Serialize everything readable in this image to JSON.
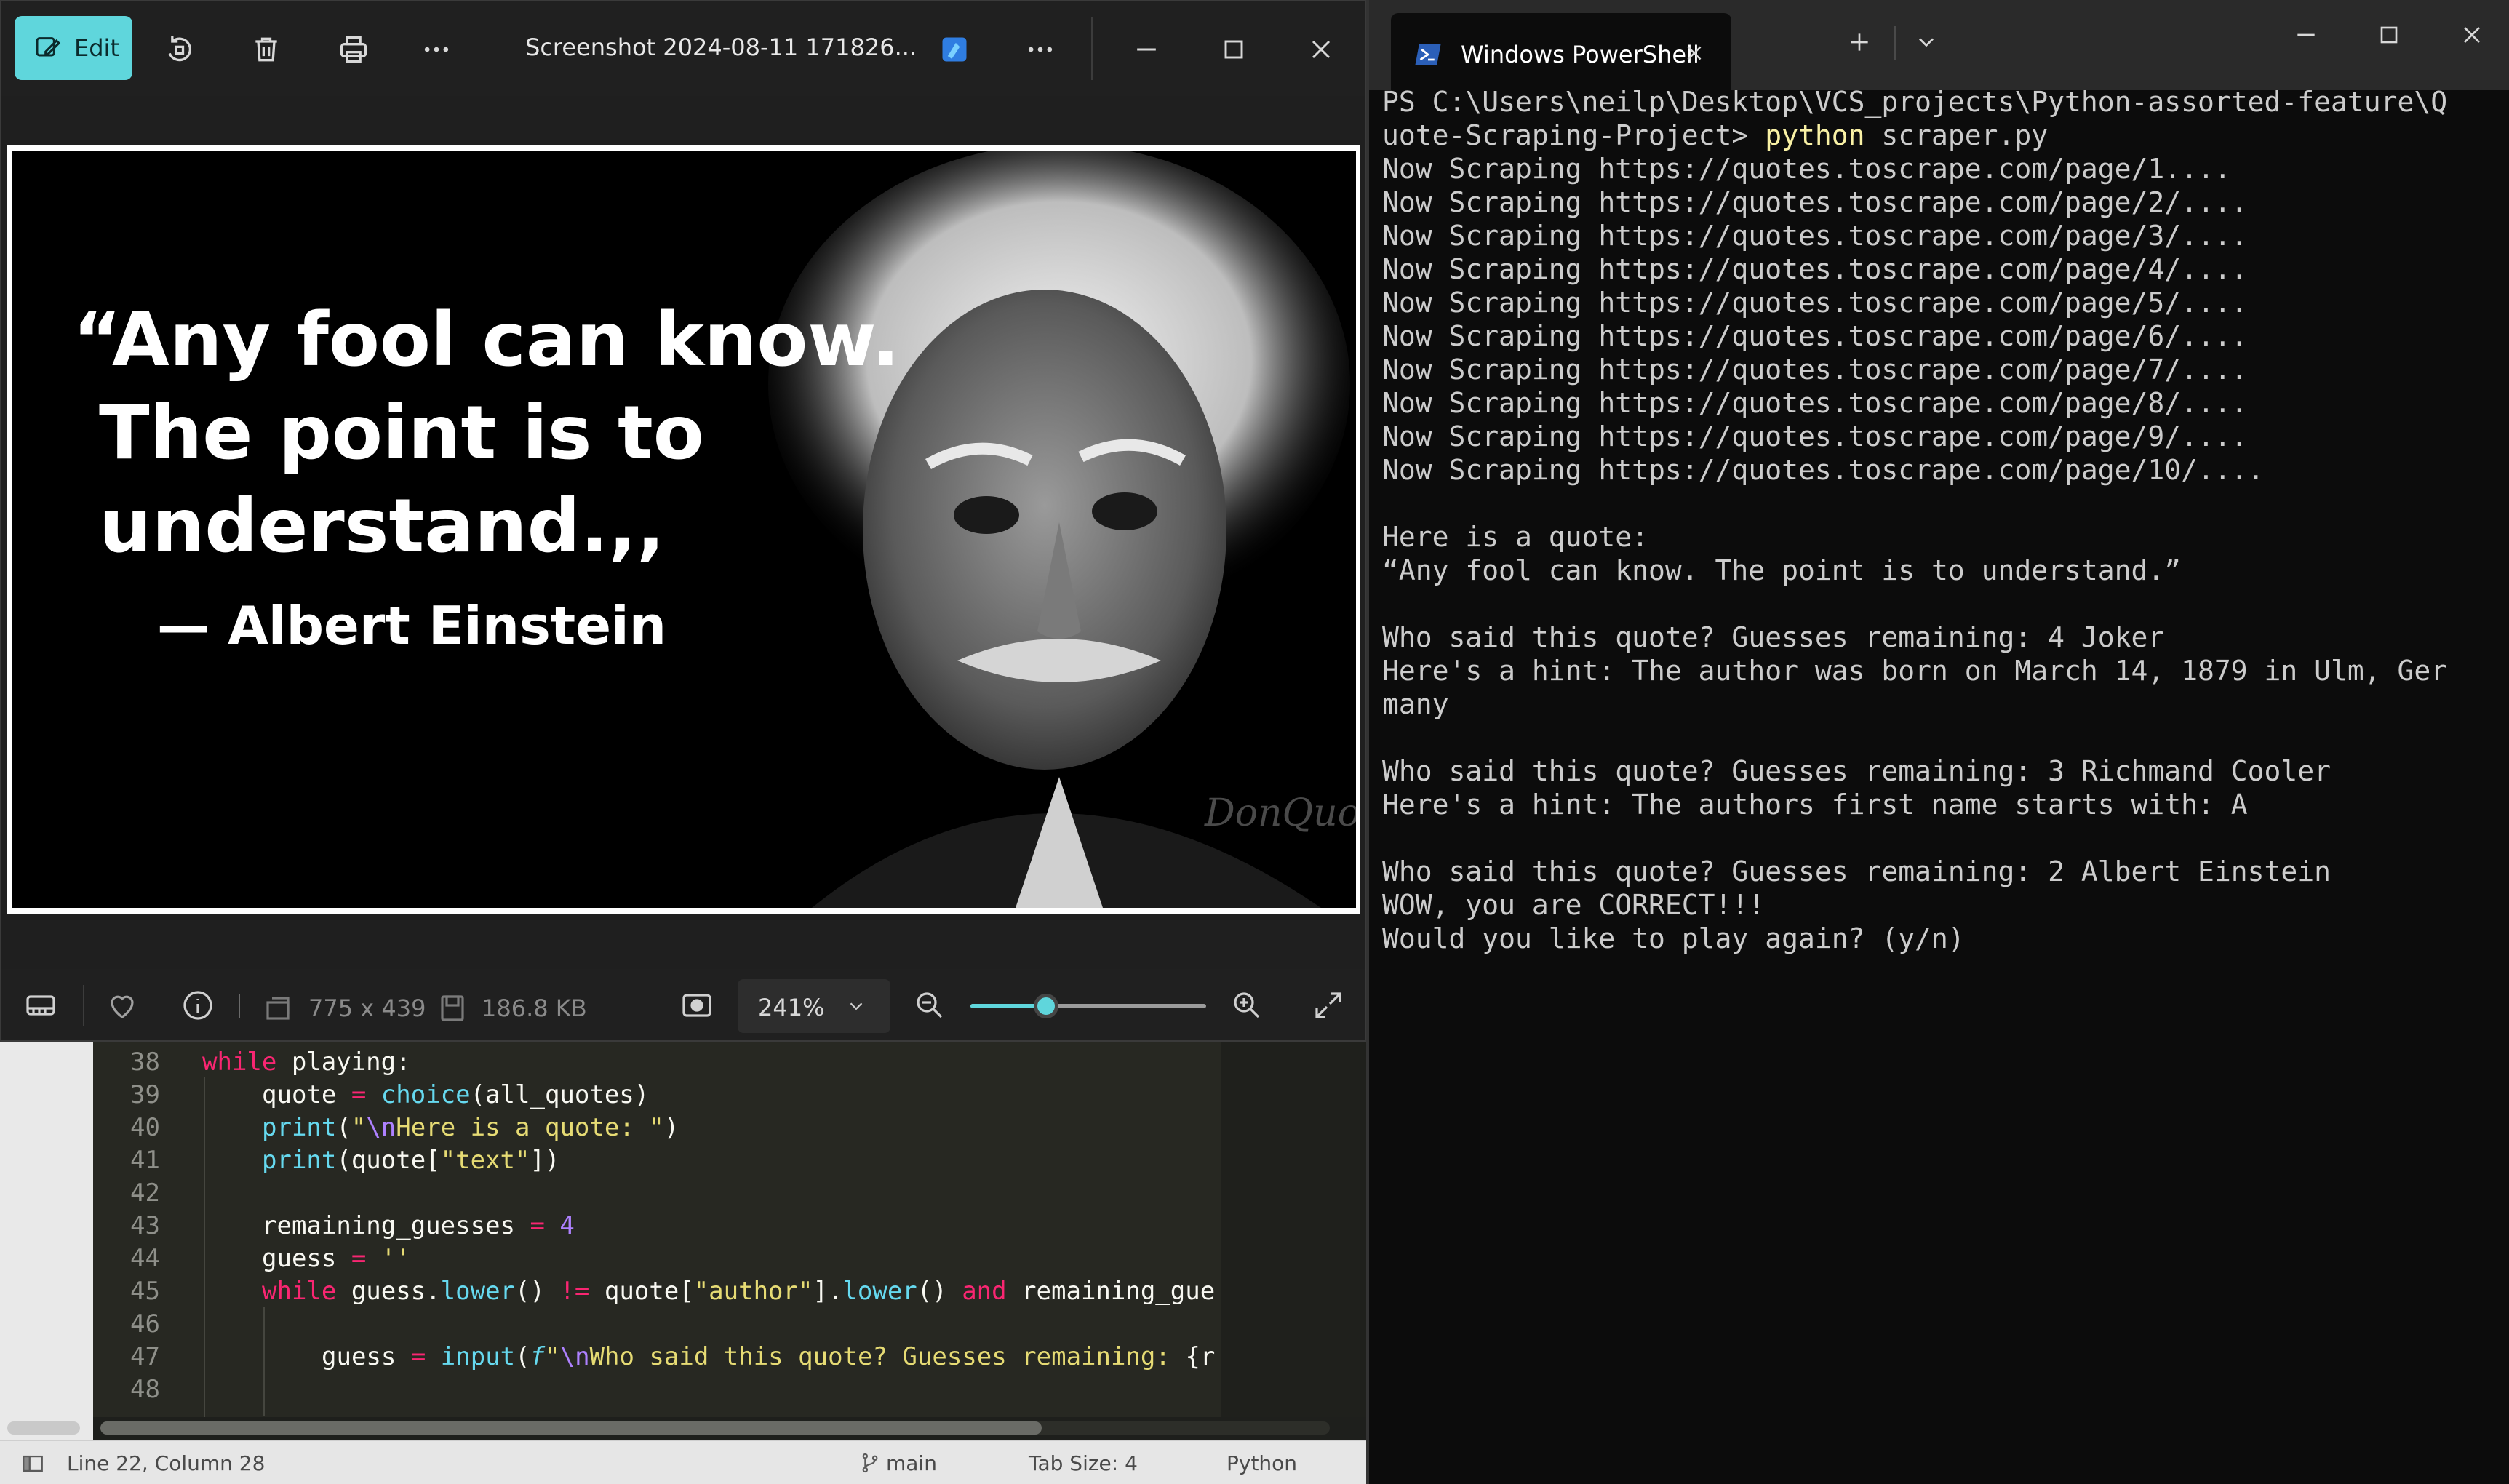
{
  "viewer": {
    "edit_label": "Edit",
    "file_title": "Screenshot 2024-08-11 171826...",
    "image": {
      "quote_lines": [
        "“Any fool can know.",
        "The point is to",
        "understand.,,",
        "— Albert Einstein"
      ],
      "watermark": "DonQuote"
    },
    "bottom": {
      "dimensions": "775 x 439",
      "file_size": "186.8 KB",
      "zoom": "241%",
      "zoom_slider_fraction": 0.32
    }
  },
  "editor": {
    "lines": [
      {
        "num": "38"
      },
      {
        "num": "39"
      },
      {
        "num": "40"
      },
      {
        "num": "41"
      },
      {
        "num": "42"
      },
      {
        "num": "43"
      },
      {
        "num": "44"
      },
      {
        "num": "45"
      },
      {
        "num": "46"
      },
      {
        "num": "47"
      },
      {
        "num": "48"
      }
    ],
    "code": {
      "l38_kw": "while",
      "l38_rest": " playing:",
      "l39_a": "quote ",
      "l39_op": "=",
      "l39_fn": " choice",
      "l39_b": "(all_quotes)",
      "l40_fn": "print",
      "l40_a": "(",
      "l40_s1": "\"",
      "l40_esc": "\\n",
      "l40_s2": "Here is a quote: \"",
      "l40_b": ")",
      "l41_fn": "print",
      "l41_a": "(quote[",
      "l41_s": "\"text\"",
      "l41_b": "])",
      "l43_a": "remaining_guesses ",
      "l43_op": "=",
      "l43_num": " 4",
      "l44_a": "guess ",
      "l44_op": "=",
      "l44_s": " ''",
      "l45_kw": "while",
      "l45_a": " guess.",
      "l45_fn1": "lower",
      "l45_b": "() ",
      "l45_op": "!=",
      "l45_c": " quote[",
      "l45_s": "\"author\"",
      "l45_d": "].",
      "l45_fn2": "lower",
      "l45_e": "() ",
      "l45_kw2": "and",
      "l45_f": " remaining_gue",
      "l47_a": "guess ",
      "l47_op": "=",
      "l47_fn": " input",
      "l47_b": "(",
      "l47_f": "f",
      "l47_s1": "\"",
      "l47_esc": "\\n",
      "l47_s2": "Who said this quote? Guesses remaining: ",
      "l47_c": "{r"
    },
    "status": {
      "position": "Line 22, Column 28",
      "branch": "main",
      "tab_size": "Tab Size: 4",
      "language": "Python"
    }
  },
  "powershell": {
    "tab_title": "Windows PowerShell",
    "prompt_line1": "PS C:\\Users\\neilp\\Desktop\\VCS_projects\\Python-assorted-feature\\Q",
    "prompt_line2_path": "uote-Scraping-Project> ",
    "prompt_cmd": "python",
    "prompt_arg": " scraper.py",
    "output": [
      "Now Scraping https://quotes.toscrape.com/page/1....",
      "Now Scraping https://quotes.toscrape.com/page/2/....",
      "Now Scraping https://quotes.toscrape.com/page/3/....",
      "Now Scraping https://quotes.toscrape.com/page/4/....",
      "Now Scraping https://quotes.toscrape.com/page/5/....",
      "Now Scraping https://quotes.toscrape.com/page/6/....",
      "Now Scraping https://quotes.toscrape.com/page/7/....",
      "Now Scraping https://quotes.toscrape.com/page/8/....",
      "Now Scraping https://quotes.toscrape.com/page/9/....",
      "Now Scraping https://quotes.toscrape.com/page/10/....",
      "",
      "Here is a quote:",
      "“Any fool can know. The point is to understand.”",
      "",
      "Who said this quote? Guesses remaining: 4 Joker",
      "Here's a hint: The author was born on March 14, 1879 in Ulm, Ger",
      "many",
      "",
      "Who said this quote? Guesses remaining: 3 Richmand Cooler",
      "Here's a hint: The authors first name starts with: A",
      "",
      "Who said this quote? Guesses remaining: 2 Albert Einstein",
      "WOW, you are CORRECT!!!",
      "Would you like to play again? (y/n)"
    ]
  }
}
